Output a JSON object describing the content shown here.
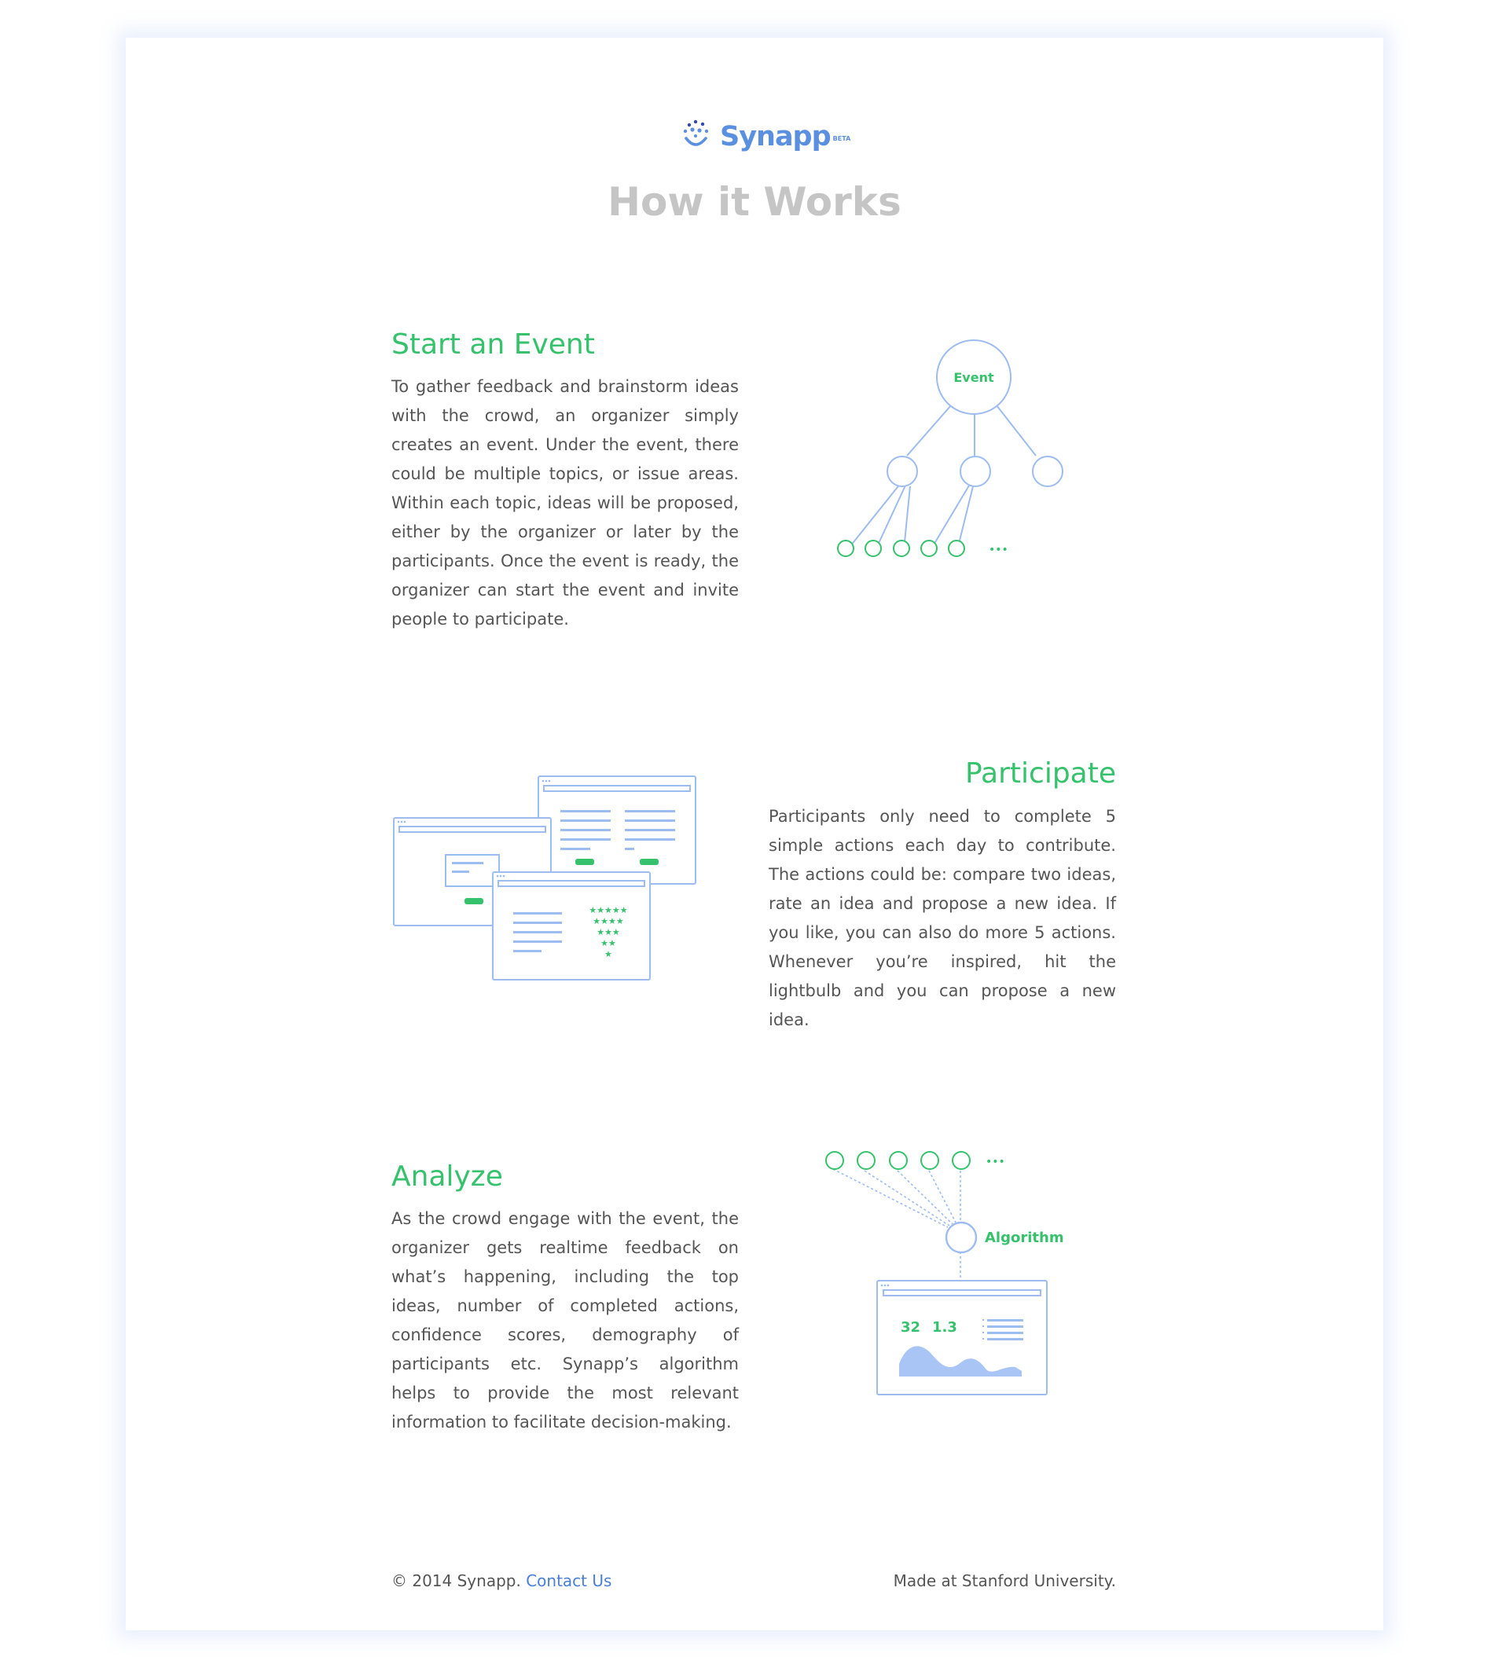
{
  "brand": {
    "name": "Synapp",
    "badge": "BETA",
    "primary_color": "#5b8fe0",
    "accent_color": "#36c26c",
    "logo_icon": "synapp-logo-icon"
  },
  "page": {
    "title": "How it Works"
  },
  "sections": [
    {
      "title": "Start an Event",
      "body": "To gather feedback and brainstorm ideas with the crowd, an organizer simply creates an event. Under the event, there could be multiple topics, or issue areas. Within each topic, ideas will be proposed, either by the organizer or later by the participants. Once the event is ready, the organizer can start the event and invite people to participate.",
      "illustration": {
        "root_label": "Event",
        "ellipsis": "•••"
      }
    },
    {
      "title": "Participate",
      "body": "Participants only need to complete 5 simple actions each day to contribute. The actions could be: compare two ideas, rate an idea and propose a new idea. If you like, you can also do more 5 actions. Whenever you’re inspired, hit the lightbulb and you can propose a new idea.",
      "illustration": {
        "stars": [
          "★★★★★",
          "★★★★",
          "★★★",
          "★★",
          "★"
        ]
      }
    },
    {
      "title": "Analyze",
      "body": "As the crowd engage with the event, the organizer gets realtime feedback on what’s happening, including the top ideas, number of completed actions, confidence scores, demography of participants etc. Synapp’s algorithm helps to provide the most relevant information to facilitate decision-making.",
      "illustration": {
        "algorithm_label": "Algorithm",
        "stat1": "32",
        "stat2": "1.3",
        "ellipsis": "•••"
      }
    }
  ],
  "footer": {
    "copyright": "© 2014 Synapp.",
    "contact_label": "Contact Us",
    "made_at": "Made at Stanford University."
  }
}
